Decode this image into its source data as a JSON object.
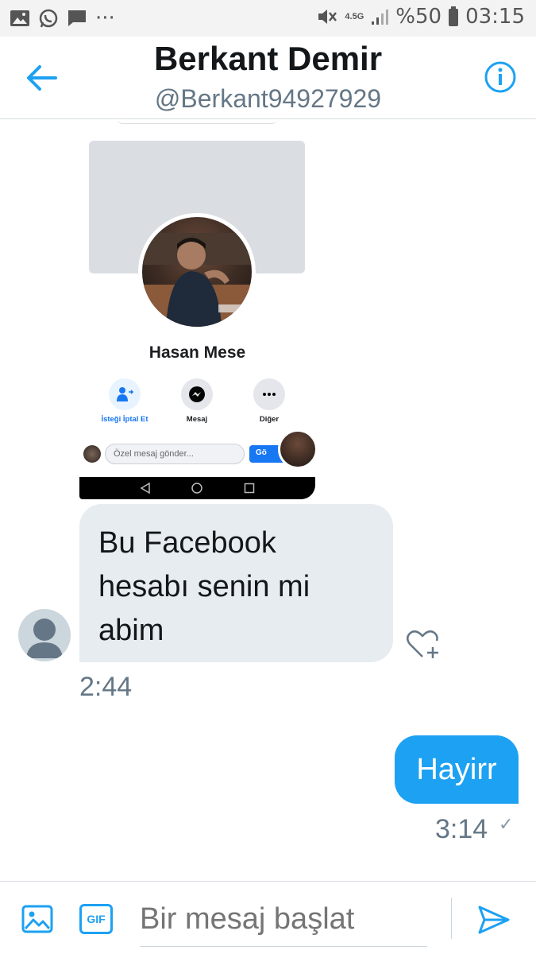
{
  "statusbar": {
    "network": "4.5G",
    "battery": "%50",
    "time": "03:15",
    "more": "···"
  },
  "header": {
    "title": "Berkant Demir",
    "handle": "@Berkant94927929"
  },
  "shared_image": {
    "profile_name": "Hasan Mese",
    "actions": [
      {
        "label": "İsteği İptal Et",
        "icon": "cancel-request-icon"
      },
      {
        "label": "Mesaj",
        "icon": "messenger-icon"
      },
      {
        "label": "Diğer",
        "icon": "more-icon"
      }
    ],
    "message_placeholder": "Özel mesaj gönder...",
    "send_label": "Gö"
  },
  "messages": {
    "incoming_text": "Bu Facebook hesabı senin mi abim",
    "incoming_time": "2:44",
    "outgoing_text": "Hayirr",
    "outgoing_time": "3:14",
    "outgoing_status": "✓"
  },
  "composer": {
    "placeholder": "Bir mesaj başlat",
    "gif_label": "GIF"
  },
  "colors": {
    "accent": "#1da1f2",
    "bubble_in": "#e6ecf0",
    "muted": "#657786"
  }
}
